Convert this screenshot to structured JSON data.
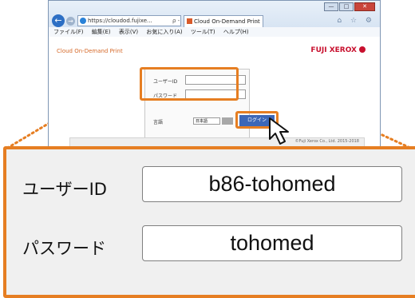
{
  "browser": {
    "address_text": "https://cloudod.fujixe...",
    "address_tools": "ρ - 🔒 C",
    "tab_title": "Cloud On-Demand Print",
    "tab_close": "×",
    "back_glyph": "←",
    "forward_glyph": "→",
    "window_buttons": [
      "—",
      "□",
      "✕"
    ],
    "tool_icons": "⌂ ☆ ⚙",
    "menu": [
      "ファイル(F)",
      "編集(E)",
      "表示(V)",
      "お気に入り(A)",
      "ツール(T)",
      "ヘルプ(H)"
    ]
  },
  "page": {
    "site_title": "Cloud On-Demand Print",
    "brand": "FUJI XEROX",
    "small_form": {
      "user_label": "ユーザーID",
      "password_label": "パスワード",
      "lang_label": "言語",
      "lang_value": "日本語",
      "login_button": "ログイン"
    },
    "copyright": "©Fuji Xerox Co., Ltd. 2015-2018"
  },
  "zoom": {
    "user_label": "ユーザーID",
    "user_value": "b86-tohomed",
    "password_label": "パスワード",
    "password_value": "tohomed"
  },
  "colors": {
    "highlight": "#e67e22",
    "login_button": "#3c67b8",
    "brand": "#c8102e"
  },
  "icons": [
    "back-icon",
    "forward-icon",
    "ie-icon",
    "tab-favicon",
    "home-icon",
    "favorites-icon",
    "settings-icon",
    "mouse-cursor-icon",
    "fujixerox-logo-icon"
  ]
}
